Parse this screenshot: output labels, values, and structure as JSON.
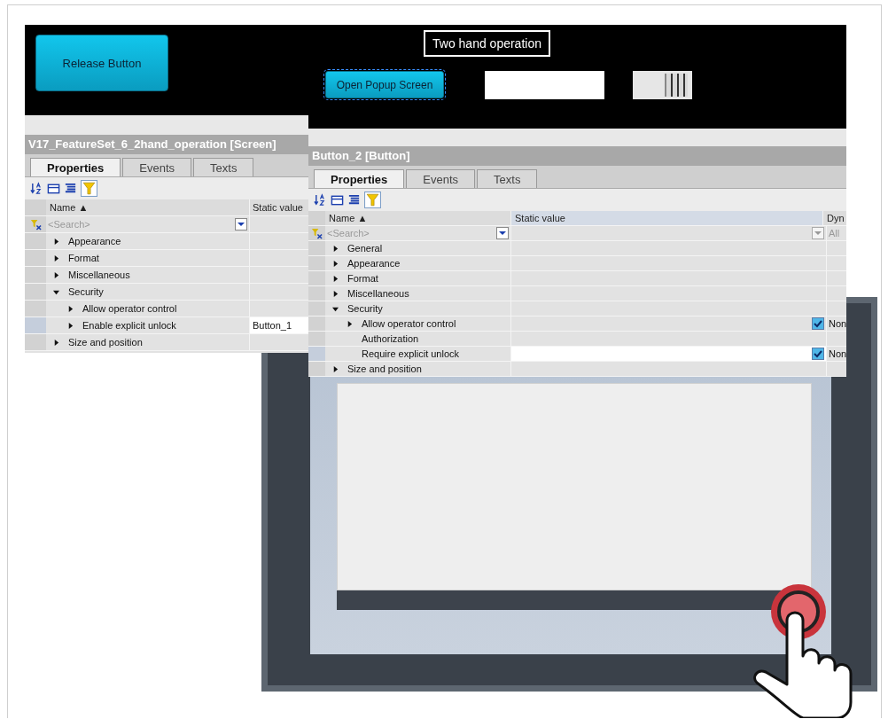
{
  "screen_canvas": {
    "release_button": "Release Button"
  },
  "left_inspector": {
    "title": "V17_FeatureSet_6_2hand_operation [Screen]",
    "tabs": [
      {
        "label": "Properties",
        "selected": true
      },
      {
        "label": "Events",
        "selected": false
      },
      {
        "label": "Texts",
        "selected": false
      }
    ],
    "columns": [
      "Name ▲",
      "Static value"
    ],
    "search": {
      "placeholder": "<Search>"
    },
    "rows": [
      {
        "label": "Appearance",
        "kind": "group",
        "expanded": false,
        "selected": false
      },
      {
        "label": "Format",
        "kind": "group",
        "expanded": false,
        "selected": false
      },
      {
        "label": "Miscellaneous",
        "kind": "group",
        "expanded": false,
        "selected": false
      },
      {
        "label": "Security",
        "kind": "group",
        "expanded": true,
        "selected": false,
        "children": [
          {
            "label": "Allow operator control",
            "kind": "group",
            "expanded": false,
            "selected": false
          },
          {
            "label": "Enable explicit unlock",
            "kind": "group",
            "expanded": false,
            "selected": true,
            "value": "Button_1"
          }
        ]
      },
      {
        "label": "Size and position",
        "kind": "group",
        "expanded": false,
        "selected": false
      }
    ]
  },
  "button_canvas": {
    "label": "Two hand operation",
    "button": {
      "label": "Open Popup Screen",
      "selected": true
    },
    "toggle": {
      "on": true
    }
  },
  "right_inspector": {
    "title": "Button_2 [Button]",
    "tabs": [
      {
        "label": "Properties",
        "selected": true
      },
      {
        "label": "Events",
        "selected": false
      },
      {
        "label": "Texts",
        "selected": false
      }
    ],
    "columns": [
      "Name ▲",
      "Static value",
      "Dyn"
    ],
    "search": {
      "placeholder": "<Search>",
      "dynamic": "All"
    },
    "rows": [
      {
        "label": "General",
        "kind": "group",
        "expanded": false,
        "selected": false
      },
      {
        "label": "Appearance",
        "kind": "group",
        "expanded": false,
        "selected": false
      },
      {
        "label": "Format",
        "kind": "group",
        "expanded": false,
        "selected": false
      },
      {
        "label": "Miscellaneous",
        "kind": "group",
        "expanded": false,
        "selected": false
      },
      {
        "label": "Security",
        "kind": "group",
        "expanded": true,
        "selected": false,
        "children": [
          {
            "label": "Allow operator control",
            "kind": "group",
            "expanded": false,
            "selected": false,
            "checked": true,
            "dynamic": "Non"
          },
          {
            "label": "Authorization",
            "kind": "leaf",
            "selected": false
          },
          {
            "label": "Require explicit unlock",
            "kind": "leaf",
            "selected": true,
            "checked": true,
            "dynamic": "Non"
          }
        ]
      },
      {
        "label": "Size and position",
        "kind": "group",
        "expanded": false,
        "selected": false
      }
    ]
  }
}
